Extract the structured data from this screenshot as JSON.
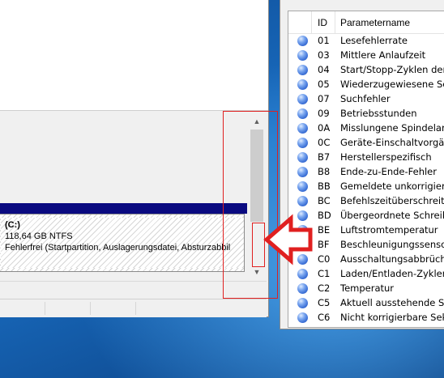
{
  "disk_management": {
    "partition": {
      "drive": "(C:)",
      "size": "118,64 GB NTFS",
      "status": "Fehlerfrei (Startpartition, Auslagerungsdatei, Absturzabbil"
    }
  },
  "smart_table": {
    "headers": {
      "id": "ID",
      "name": "Parametername"
    },
    "rows": [
      {
        "id": "01",
        "name": "Lesefehlerrate"
      },
      {
        "id": "03",
        "name": "Mittlere Anlaufzeit"
      },
      {
        "id": "04",
        "name": "Start/Stopp-Zyklen der"
      },
      {
        "id": "05",
        "name": "Wiederzugewiesene Se"
      },
      {
        "id": "07",
        "name": "Suchfehler"
      },
      {
        "id": "09",
        "name": "Betriebsstunden"
      },
      {
        "id": "0A",
        "name": "Misslungene Spindelani"
      },
      {
        "id": "0C",
        "name": "Geräte-Einschaltvorgän"
      },
      {
        "id": "B7",
        "name": "Herstellerspezifisch"
      },
      {
        "id": "B8",
        "name": "Ende-zu-Ende-Fehler"
      },
      {
        "id": "BB",
        "name": "Gemeldete unkorrigierb"
      },
      {
        "id": "BC",
        "name": "Befehlszeitüberschreitu"
      },
      {
        "id": "BD",
        "name": "Übergeordnete Schreibt"
      },
      {
        "id": "BE",
        "name": "Luftstromtemperatur"
      },
      {
        "id": "BF",
        "name": "Beschleunigungssensor"
      },
      {
        "id": "C0",
        "name": "Ausschaltungsabbrüche"
      },
      {
        "id": "C1",
        "name": "Laden/Entladen-Zyklen"
      },
      {
        "id": "C2",
        "name": "Temperatur"
      },
      {
        "id": "C5",
        "name": "Aktuell ausstehende Se"
      },
      {
        "id": "C6",
        "name": "Nicht korrigierbare Sekt"
      }
    ]
  },
  "colors": {
    "annotation": "#e02020",
    "disk_bar": "#0a0a80",
    "status_dot": "#3b6fd6"
  }
}
